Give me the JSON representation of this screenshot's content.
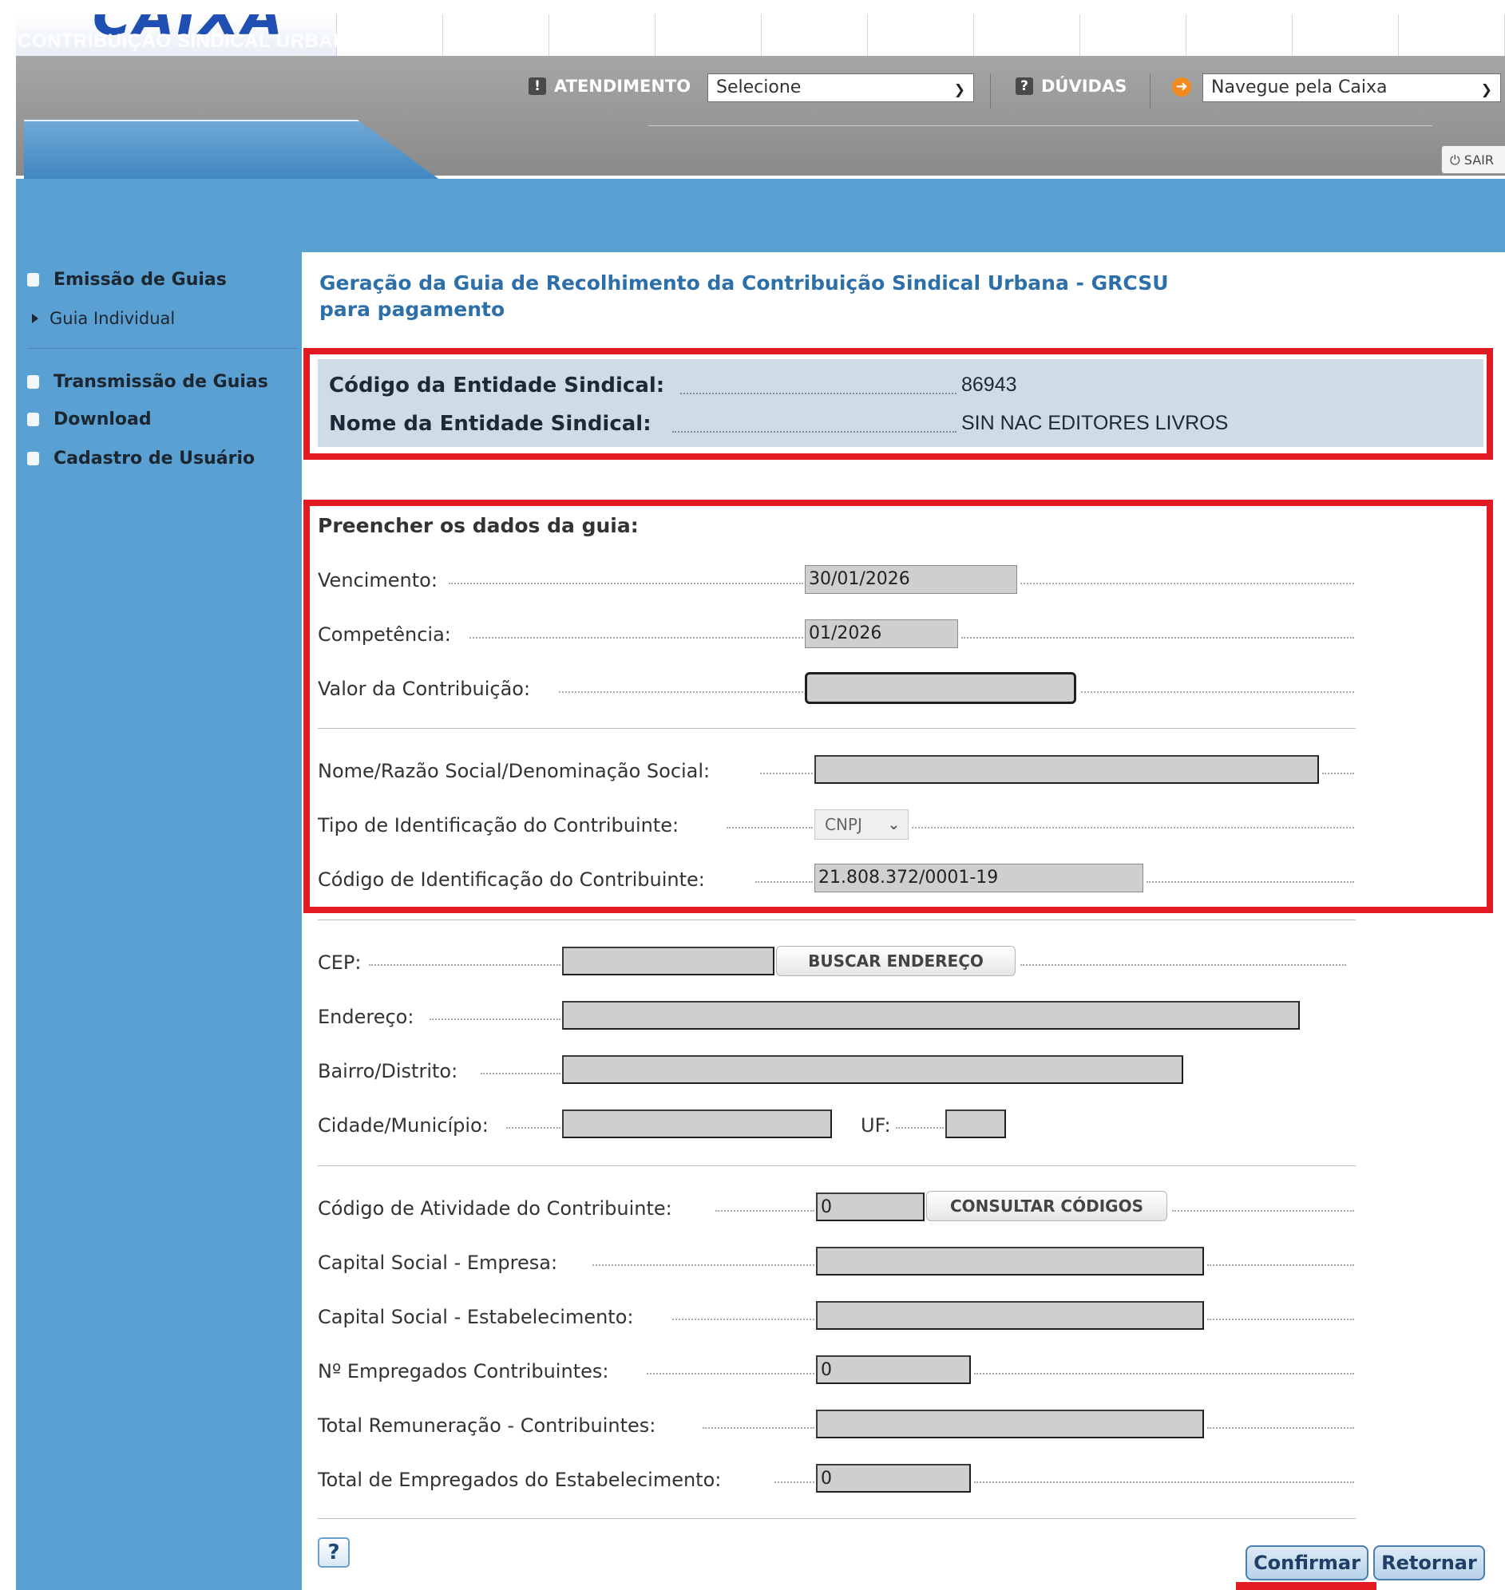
{
  "header": {
    "logo_text": "CAIXA",
    "atendimento_label": "ATENDIMENTO",
    "atendimento_select": "Selecione",
    "duvidas_label": "DÚVIDAS",
    "navegue_select": "Navegue pela Caixa",
    "section_title": "CONTRIBUIÇÃO SINDICAL URBANA",
    "sair_label": "SAIR"
  },
  "sidebar": {
    "emissao": "Emissão de Guias",
    "guia_individual": "Guia Individual",
    "transmissao": "Transmissão de Guias",
    "download": "Download",
    "cadastro": "Cadastro de Usuário"
  },
  "main": {
    "title_line1": "Geração da Guia de Recolhimento da Contribuição Sindical Urbana - GRCSU",
    "title_line2": "para pagamento",
    "entity": {
      "codigo_label": "Código da Entidade Sindical:",
      "codigo_value": "86943",
      "nome_label": "Nome da Entidade Sindical:",
      "nome_value": "SIN NAC EDITORES LIVROS"
    },
    "form": {
      "section_title": "Preencher os dados da guia:",
      "vencimento_label": "Vencimento:",
      "vencimento_value": "30/01/2026",
      "competencia_label": "Competência:",
      "competencia_value": "01/2026",
      "valor_label": "Valor da Contribuição:",
      "valor_value": "",
      "nome_razao_label": "Nome/Razão Social/Denominação Social:",
      "nome_razao_value": "",
      "tipo_label": "Tipo de Identificação do Contribuinte:",
      "tipo_value": "CNPJ",
      "codigo_id_label": "Código de Identificação do Contribuinte:",
      "codigo_id_value": "21.808.372/0001-19",
      "cep_label": "CEP:",
      "cep_value": "",
      "buscar_label": "BUSCAR ENDEREÇO",
      "endereco_label": "Endereço:",
      "bairro_label": "Bairro/Distrito:",
      "cidade_label": "Cidade/Município:",
      "uf_label": "UF:",
      "atividade_label": "Código de Atividade do Contribuinte:",
      "atividade_value": "0",
      "consultar_label": "CONSULTAR CÓDIGOS",
      "capital_empresa_label": "Capital Social - Empresa:",
      "capital_estab_label": "Capital Social - Estabelecimento:",
      "empregados_label": "Nº Empregados Contribuintes:",
      "empregados_value": "0",
      "total_remun_label": "Total Remuneração - Contribuintes:",
      "total_empregados_label": "Total de Empregados do Estabelecimento:",
      "total_empregados_value": "0"
    },
    "buttons": {
      "help": "?",
      "confirmar": "Confirmar",
      "retornar": "Retornar"
    }
  },
  "colors": {
    "sidebar_blue": "#5aa0d2",
    "highlight_red": "#e21a23",
    "title_blue": "#2d6fa8"
  }
}
